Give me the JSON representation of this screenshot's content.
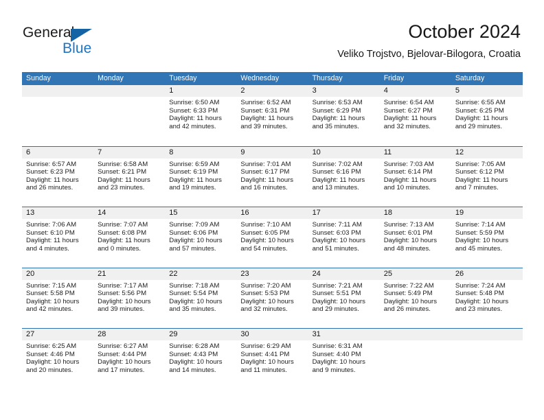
{
  "brand": {
    "name_top": "General",
    "name_bottom": "Blue",
    "accent_color": "#1d74c4",
    "triangle_color": "#1464a5"
  },
  "header": {
    "month_title": "October 2024",
    "location": "Veliko Trojstvo, Bjelovar-Bilogora, Croatia"
  },
  "calendar": {
    "header_bg": "#3175b4",
    "daynum_band_bg": "#f0f0f0",
    "row_divider": "#2f6fae",
    "weekdays": [
      "Sunday",
      "Monday",
      "Tuesday",
      "Wednesday",
      "Thursday",
      "Friday",
      "Saturday"
    ],
    "weeks": [
      [
        {
          "day": "",
          "empty": true
        },
        {
          "day": "",
          "empty": true
        },
        {
          "day": "1",
          "sunrise": "Sunrise: 6:50 AM",
          "sunset": "Sunset: 6:33 PM",
          "daylight_line1": "Daylight: 11 hours",
          "daylight_line2": "and 42 minutes."
        },
        {
          "day": "2",
          "sunrise": "Sunrise: 6:52 AM",
          "sunset": "Sunset: 6:31 PM",
          "daylight_line1": "Daylight: 11 hours",
          "daylight_line2": "and 39 minutes."
        },
        {
          "day": "3",
          "sunrise": "Sunrise: 6:53 AM",
          "sunset": "Sunset: 6:29 PM",
          "daylight_line1": "Daylight: 11 hours",
          "daylight_line2": "and 35 minutes."
        },
        {
          "day": "4",
          "sunrise": "Sunrise: 6:54 AM",
          "sunset": "Sunset: 6:27 PM",
          "daylight_line1": "Daylight: 11 hours",
          "daylight_line2": "and 32 minutes."
        },
        {
          "day": "5",
          "sunrise": "Sunrise: 6:55 AM",
          "sunset": "Sunset: 6:25 PM",
          "daylight_line1": "Daylight: 11 hours",
          "daylight_line2": "and 29 minutes."
        }
      ],
      [
        {
          "day": "6",
          "sunrise": "Sunrise: 6:57 AM",
          "sunset": "Sunset: 6:23 PM",
          "daylight_line1": "Daylight: 11 hours",
          "daylight_line2": "and 26 minutes."
        },
        {
          "day": "7",
          "sunrise": "Sunrise: 6:58 AM",
          "sunset": "Sunset: 6:21 PM",
          "daylight_line1": "Daylight: 11 hours",
          "daylight_line2": "and 23 minutes."
        },
        {
          "day": "8",
          "sunrise": "Sunrise: 6:59 AM",
          "sunset": "Sunset: 6:19 PM",
          "daylight_line1": "Daylight: 11 hours",
          "daylight_line2": "and 19 minutes."
        },
        {
          "day": "9",
          "sunrise": "Sunrise: 7:01 AM",
          "sunset": "Sunset: 6:17 PM",
          "daylight_line1": "Daylight: 11 hours",
          "daylight_line2": "and 16 minutes."
        },
        {
          "day": "10",
          "sunrise": "Sunrise: 7:02 AM",
          "sunset": "Sunset: 6:16 PM",
          "daylight_line1": "Daylight: 11 hours",
          "daylight_line2": "and 13 minutes."
        },
        {
          "day": "11",
          "sunrise": "Sunrise: 7:03 AM",
          "sunset": "Sunset: 6:14 PM",
          "daylight_line1": "Daylight: 11 hours",
          "daylight_line2": "and 10 minutes."
        },
        {
          "day": "12",
          "sunrise": "Sunrise: 7:05 AM",
          "sunset": "Sunset: 6:12 PM",
          "daylight_line1": "Daylight: 11 hours",
          "daylight_line2": "and 7 minutes."
        }
      ],
      [
        {
          "day": "13",
          "sunrise": "Sunrise: 7:06 AM",
          "sunset": "Sunset: 6:10 PM",
          "daylight_line1": "Daylight: 11 hours",
          "daylight_line2": "and 4 minutes."
        },
        {
          "day": "14",
          "sunrise": "Sunrise: 7:07 AM",
          "sunset": "Sunset: 6:08 PM",
          "daylight_line1": "Daylight: 11 hours",
          "daylight_line2": "and 0 minutes."
        },
        {
          "day": "15",
          "sunrise": "Sunrise: 7:09 AM",
          "sunset": "Sunset: 6:06 PM",
          "daylight_line1": "Daylight: 10 hours",
          "daylight_line2": "and 57 minutes."
        },
        {
          "day": "16",
          "sunrise": "Sunrise: 7:10 AM",
          "sunset": "Sunset: 6:05 PM",
          "daylight_line1": "Daylight: 10 hours",
          "daylight_line2": "and 54 minutes."
        },
        {
          "day": "17",
          "sunrise": "Sunrise: 7:11 AM",
          "sunset": "Sunset: 6:03 PM",
          "daylight_line1": "Daylight: 10 hours",
          "daylight_line2": "and 51 minutes."
        },
        {
          "day": "18",
          "sunrise": "Sunrise: 7:13 AM",
          "sunset": "Sunset: 6:01 PM",
          "daylight_line1": "Daylight: 10 hours",
          "daylight_line2": "and 48 minutes."
        },
        {
          "day": "19",
          "sunrise": "Sunrise: 7:14 AM",
          "sunset": "Sunset: 5:59 PM",
          "daylight_line1": "Daylight: 10 hours",
          "daylight_line2": "and 45 minutes."
        }
      ],
      [
        {
          "day": "20",
          "sunrise": "Sunrise: 7:15 AM",
          "sunset": "Sunset: 5:58 PM",
          "daylight_line1": "Daylight: 10 hours",
          "daylight_line2": "and 42 minutes."
        },
        {
          "day": "21",
          "sunrise": "Sunrise: 7:17 AM",
          "sunset": "Sunset: 5:56 PM",
          "daylight_line1": "Daylight: 10 hours",
          "daylight_line2": "and 39 minutes."
        },
        {
          "day": "22",
          "sunrise": "Sunrise: 7:18 AM",
          "sunset": "Sunset: 5:54 PM",
          "daylight_line1": "Daylight: 10 hours",
          "daylight_line2": "and 35 minutes."
        },
        {
          "day": "23",
          "sunrise": "Sunrise: 7:20 AM",
          "sunset": "Sunset: 5:53 PM",
          "daylight_line1": "Daylight: 10 hours",
          "daylight_line2": "and 32 minutes."
        },
        {
          "day": "24",
          "sunrise": "Sunrise: 7:21 AM",
          "sunset": "Sunset: 5:51 PM",
          "daylight_line1": "Daylight: 10 hours",
          "daylight_line2": "and 29 minutes."
        },
        {
          "day": "25",
          "sunrise": "Sunrise: 7:22 AM",
          "sunset": "Sunset: 5:49 PM",
          "daylight_line1": "Daylight: 10 hours",
          "daylight_line2": "and 26 minutes."
        },
        {
          "day": "26",
          "sunrise": "Sunrise: 7:24 AM",
          "sunset": "Sunset: 5:48 PM",
          "daylight_line1": "Daylight: 10 hours",
          "daylight_line2": "and 23 minutes."
        }
      ],
      [
        {
          "day": "27",
          "sunrise": "Sunrise: 6:25 AM",
          "sunset": "Sunset: 4:46 PM",
          "daylight_line1": "Daylight: 10 hours",
          "daylight_line2": "and 20 minutes."
        },
        {
          "day": "28",
          "sunrise": "Sunrise: 6:27 AM",
          "sunset": "Sunset: 4:44 PM",
          "daylight_line1": "Daylight: 10 hours",
          "daylight_line2": "and 17 minutes."
        },
        {
          "day": "29",
          "sunrise": "Sunrise: 6:28 AM",
          "sunset": "Sunset: 4:43 PM",
          "daylight_line1": "Daylight: 10 hours",
          "daylight_line2": "and 14 minutes."
        },
        {
          "day": "30",
          "sunrise": "Sunrise: 6:29 AM",
          "sunset": "Sunset: 4:41 PM",
          "daylight_line1": "Daylight: 10 hours",
          "daylight_line2": "and 11 minutes."
        },
        {
          "day": "31",
          "sunrise": "Sunrise: 6:31 AM",
          "sunset": "Sunset: 4:40 PM",
          "daylight_line1": "Daylight: 10 hours",
          "daylight_line2": "and 9 minutes."
        },
        {
          "day": "",
          "empty": true
        },
        {
          "day": "",
          "empty": true
        }
      ]
    ]
  }
}
